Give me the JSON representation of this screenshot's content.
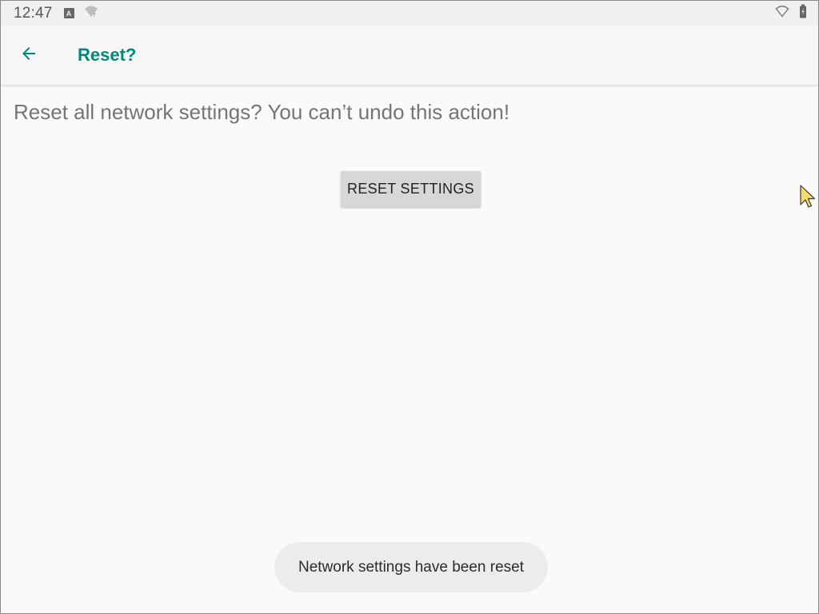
{
  "status_bar": {
    "time": "12:47",
    "notification_icon_letter": "A",
    "icons": [
      "notification-a-icon",
      "wifi-question-icon",
      "wifi-outline-icon",
      "battery-icon"
    ]
  },
  "app_bar": {
    "back_icon": "arrow-left-icon",
    "title": "Reset?"
  },
  "content": {
    "description": "Reset all network settings? You can’t undo this action!",
    "reset_button_label": "RESET SETTINGS"
  },
  "toast": {
    "message": "Network settings have been reset"
  },
  "colors": {
    "accent": "#00897b",
    "background": "#fafafa",
    "button": "#d6d7d7",
    "toast": "#ececec",
    "cursor": "#f2dd6b"
  }
}
